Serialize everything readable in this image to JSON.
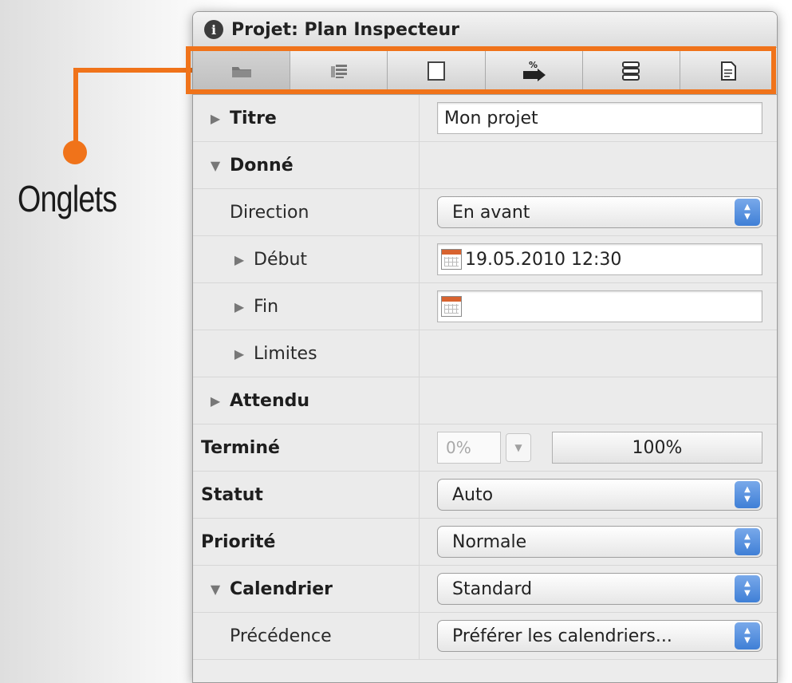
{
  "callout": {
    "label": "Onglets",
    "color": "#f0731a"
  },
  "window": {
    "title": "Projet: Plan Inspecteur",
    "info_icon": "info-icon",
    "tabs": [
      {
        "icon": "folder-icon",
        "active": true
      },
      {
        "icon": "resources-icon",
        "active": false
      },
      {
        "icon": "square-icon",
        "active": false
      },
      {
        "icon": "percent-arrow-icon",
        "active": false
      },
      {
        "icon": "stack-icon",
        "active": false
      },
      {
        "icon": "document-icon",
        "active": false
      }
    ]
  },
  "rows": {
    "titre": {
      "label": "Titre",
      "value": "Mon projet"
    },
    "donne": {
      "label": "Donné"
    },
    "direction": {
      "label": "Direction",
      "value": "En avant"
    },
    "debut": {
      "label": "Début",
      "value": "19.05.2010 12:30"
    },
    "fin": {
      "label": "Fin",
      "value": ""
    },
    "limites": {
      "label": "Limites"
    },
    "attendu": {
      "label": "Attendu"
    },
    "termine": {
      "label": "Terminé",
      "value": "0%",
      "button": "100%"
    },
    "statut": {
      "label": "Statut",
      "value": "Auto"
    },
    "priorite": {
      "label": "Priorité",
      "value": "Normale"
    },
    "calendrier": {
      "label": "Calendrier",
      "value": "Standard"
    },
    "precedence": {
      "label": "Précédence",
      "value": "Préférer les calendriers..."
    }
  },
  "colors": {
    "accent": "#f0731a",
    "select_blue": "#3f7fd6"
  }
}
